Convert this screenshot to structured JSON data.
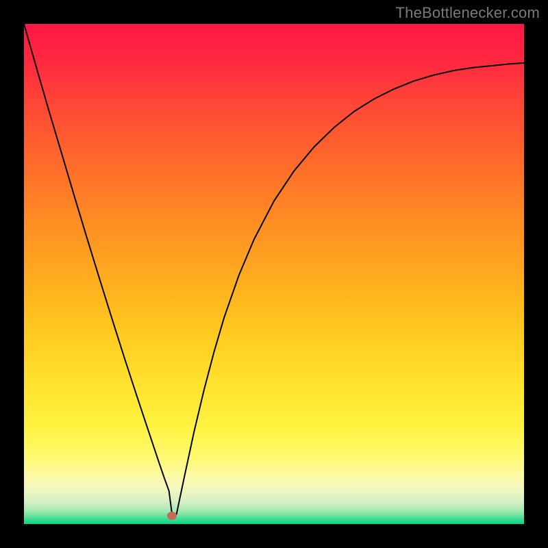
{
  "watermark": "TheBottlenecker.com",
  "gradient_stops": [
    {
      "offset": 0.0,
      "color": "#ff1745"
    },
    {
      "offset": 0.08,
      "color": "#ff2a3f"
    },
    {
      "offset": 0.16,
      "color": "#ff4736"
    },
    {
      "offset": 0.24,
      "color": "#ff5f2e"
    },
    {
      "offset": 0.32,
      "color": "#ff7728"
    },
    {
      "offset": 0.4,
      "color": "#ff8e23"
    },
    {
      "offset": 0.48,
      "color": "#ffa420"
    },
    {
      "offset": 0.56,
      "color": "#ffba1e"
    },
    {
      "offset": 0.64,
      "color": "#ffd023"
    },
    {
      "offset": 0.72,
      "color": "#ffe22d"
    },
    {
      "offset": 0.8,
      "color": "#fff23f"
    },
    {
      "offset": 0.86,
      "color": "#fff96a"
    },
    {
      "offset": 0.9,
      "color": "#fdfaa0"
    },
    {
      "offset": 0.93,
      "color": "#f2f7c0"
    },
    {
      "offset": 0.955,
      "color": "#d6f0c5"
    },
    {
      "offset": 0.975,
      "color": "#9de8ae"
    },
    {
      "offset": 0.99,
      "color": "#40dd90"
    },
    {
      "offset": 1.0,
      "color": "#00d884"
    }
  ],
  "marker": {
    "x_frac": 0.296,
    "y_frac": 0.983,
    "color": "#c56a5a"
  },
  "chart_data": {
    "type": "line",
    "title": "",
    "xlabel": "",
    "ylabel": "",
    "xlim": [
      0,
      1
    ],
    "ylim": [
      0,
      1
    ],
    "x": [
      0.0,
      0.025,
      0.05,
      0.075,
      0.1,
      0.125,
      0.15,
      0.175,
      0.2,
      0.225,
      0.25,
      0.26,
      0.27,
      0.28,
      0.29,
      0.296,
      0.305,
      0.32,
      0.34,
      0.36,
      0.38,
      0.4,
      0.43,
      0.46,
      0.5,
      0.54,
      0.58,
      0.62,
      0.66,
      0.7,
      0.74,
      0.78,
      0.82,
      0.86,
      0.9,
      0.94,
      0.97,
      1.0
    ],
    "values": [
      1.0,
      0.912,
      0.826,
      0.742,
      0.658,
      0.575,
      0.494,
      0.414,
      0.335,
      0.258,
      0.183,
      0.153,
      0.123,
      0.094,
      0.066,
      0.02,
      0.02,
      0.091,
      0.184,
      0.268,
      0.344,
      0.412,
      0.498,
      0.569,
      0.646,
      0.706,
      0.754,
      0.793,
      0.825,
      0.85,
      0.87,
      0.886,
      0.898,
      0.907,
      0.913,
      0.917,
      0.92,
      0.922
    ],
    "series": [
      {
        "name": "curve",
        "stroke": "#000000",
        "stroke_width": 2
      }
    ],
    "annotations": [
      {
        "type": "marker",
        "x": 0.296,
        "y": 0.017,
        "color": "#c56a5a"
      }
    ],
    "grid": false,
    "legend": false
  }
}
